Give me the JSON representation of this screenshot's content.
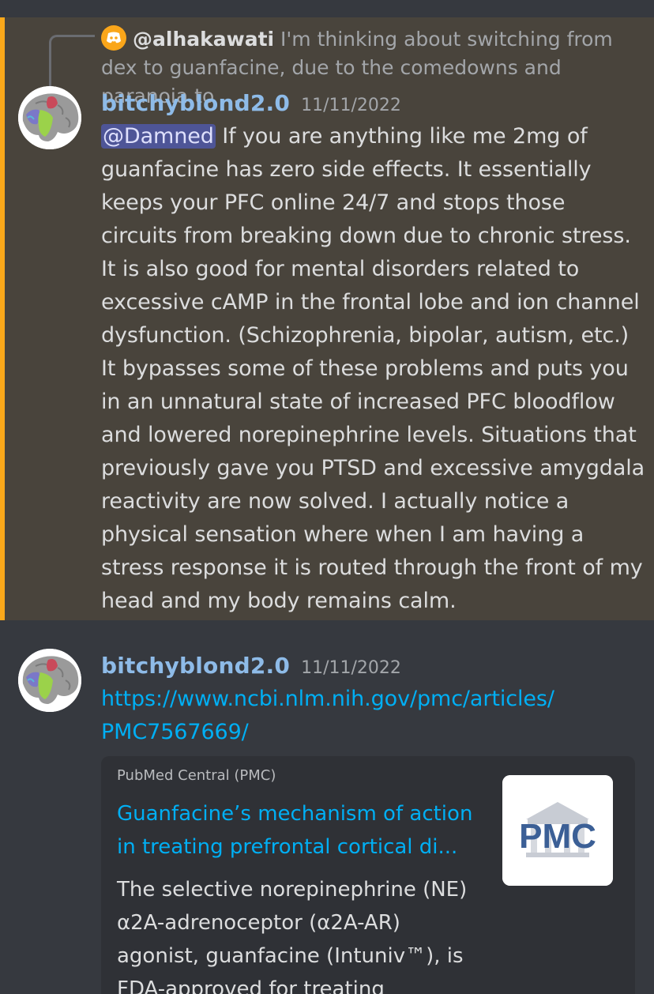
{
  "reply": {
    "author": "@alhakawati",
    "preview": "I'm thinking about switching from dex to guanfacine, due to the comedowns and paranoia to ..."
  },
  "messages": [
    {
      "author": "bitchyblond2.0",
      "timestamp": "11/11/2022",
      "mention": "@Damned",
      "text": "If you are anything like me 2mg of guanfacine has zero side effects. It essentially keeps your PFC online 24/7 and stops those circuits from breaking down due to chronic stress. It is also good for mental disorders related to excessive cAMP in the frontal lobe and ion channel dysfunction. (Schizophrenia, bipolar, autism, etc.) It bypasses some of these problems and puts you in an unnatural state of increased PFC bloodflow and lowered norepinephrine levels. Situations that previously gave you PTSD and excessive amygdala reactivity are now solved. I actually notice a physical sensation where when I am having a stress response it is routed through the front of my head and my body remains calm."
    },
    {
      "author": "bitchyblond2.0",
      "timestamp": "11/11/2022",
      "link_line1": "https://www.ncbi.nlm.nih.gov/pmc/articles/",
      "link_line2": "PMC7567669/"
    }
  ],
  "embed": {
    "provider": "PubMed Central (PMC)",
    "title_line1": "Guanfacine’s mechanism of action",
    "title_line2": "in treating prefrontal cortical di...",
    "desc_line1": "The selective norepinephrine (NE)",
    "desc_line2": "α2A-adrenoceptor (α2A-AR)",
    "desc_line3": "agonist, guanfacine (Intuniv™), is",
    "desc_line4": "FDA-approved for treating",
    "thumbnail_text": "PMC"
  },
  "icons": {
    "reply_app_icon": "discord-icon",
    "avatar": "brain-avatar"
  },
  "colors": {
    "background": "#36393f",
    "highlight": "#49443c",
    "mention_bar": "#faa81a",
    "author": "#8ebbe8",
    "link": "#00aff4",
    "mention_bg": "#4e5597"
  }
}
